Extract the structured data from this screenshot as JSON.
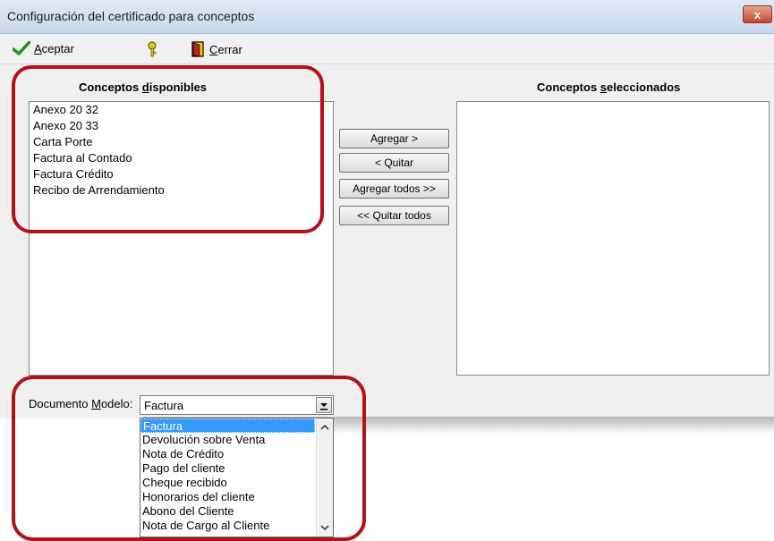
{
  "window": {
    "title": "Configuración del certificado para conceptos",
    "close_glyph": "x"
  },
  "toolbar": {
    "accept_mnemonic": "A",
    "accept_rest": "ceptar",
    "close_mnemonic": "C",
    "close_rest": "errar"
  },
  "available": {
    "heading_pre": "Conceptos ",
    "heading_mnemonic": "d",
    "heading_post": "isponibles",
    "items": [
      "Anexo 20 32",
      "Anexo 20 33",
      "Carta Porte",
      "Factura al Contado",
      "Factura Crédito",
      "Recibo de Arrendamiento"
    ]
  },
  "selected": {
    "heading_pre": "Conceptos ",
    "heading_mnemonic": "s",
    "heading_post": "eleccionados",
    "items": []
  },
  "buttons": {
    "add": "Agregar >",
    "remove": "< Quitar",
    "add_all": "Agregar todos >>",
    "remove_all": "<< Quitar todos"
  },
  "document_model": {
    "label_pre": "Documento ",
    "label_mnemonic": "M",
    "label_post": "odelo:",
    "value": "Factura",
    "options": [
      "Factura",
      "Devolución sobre Venta",
      "Nota de Crédito",
      "Pago del cliente",
      "Cheque recibido",
      "Honorarios del cliente",
      "Abono del Cliente",
      "Nota de Cargo al Cliente"
    ]
  },
  "colors": {
    "annotation": "#b3121a",
    "selection": "#3399ff",
    "accept_check": "#1f9a1f"
  },
  "icons": {
    "accept": "check-icon",
    "help": "key-icon",
    "close": "door-exit-icon",
    "dropdown": "chevron-down-icon"
  }
}
